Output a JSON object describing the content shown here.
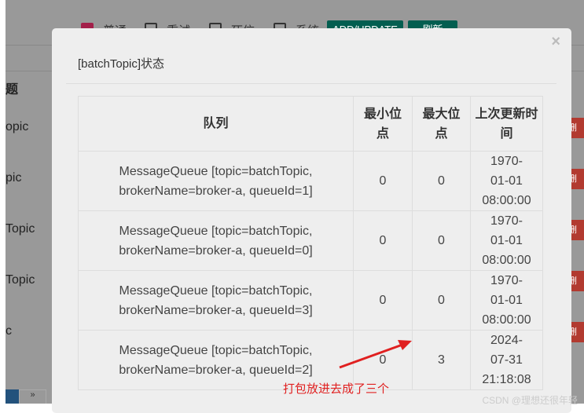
{
  "background": {
    "filters": [
      "普通",
      "重试",
      "死信",
      "系统"
    ],
    "buttons": [
      "ADD/UPDATE",
      "刷新"
    ],
    "column_header": "题",
    "row_fragments": [
      "opic",
      "pic",
      "Topic",
      "Topic",
      "c"
    ],
    "row_action": "删除",
    "pager_next": "»"
  },
  "modal": {
    "title": "[batchTopic]状态",
    "close": "×",
    "headers": [
      "队列",
      "最小位点",
      "最大位点",
      "上次更新时间"
    ],
    "rows": [
      {
        "queue": "MessageQueue [topic=batchTopic, brokerName=broker-a, queueId=1]",
        "min": "0",
        "max": "0",
        "time": "1970-01-01 08:00:00"
      },
      {
        "queue": "MessageQueue [topic=batchTopic, brokerName=broker-a, queueId=0]",
        "min": "0",
        "max": "0",
        "time": "1970-01-01 08:00:00"
      },
      {
        "queue": "MessageQueue [topic=batchTopic, brokerName=broker-a, queueId=3]",
        "min": "0",
        "max": "0",
        "time": "1970-01-01 08:00:00"
      },
      {
        "queue": "MessageQueue [topic=batchTopic, brokerName=broker-a, queueId=2]",
        "min": "0",
        "max": "3",
        "time": "2024-07-31 21:18:08"
      }
    ]
  },
  "annotation": {
    "text": "打包放进去成了三个",
    "color": "#e02020"
  },
  "watermark": "CSDN @理想还很年轻"
}
